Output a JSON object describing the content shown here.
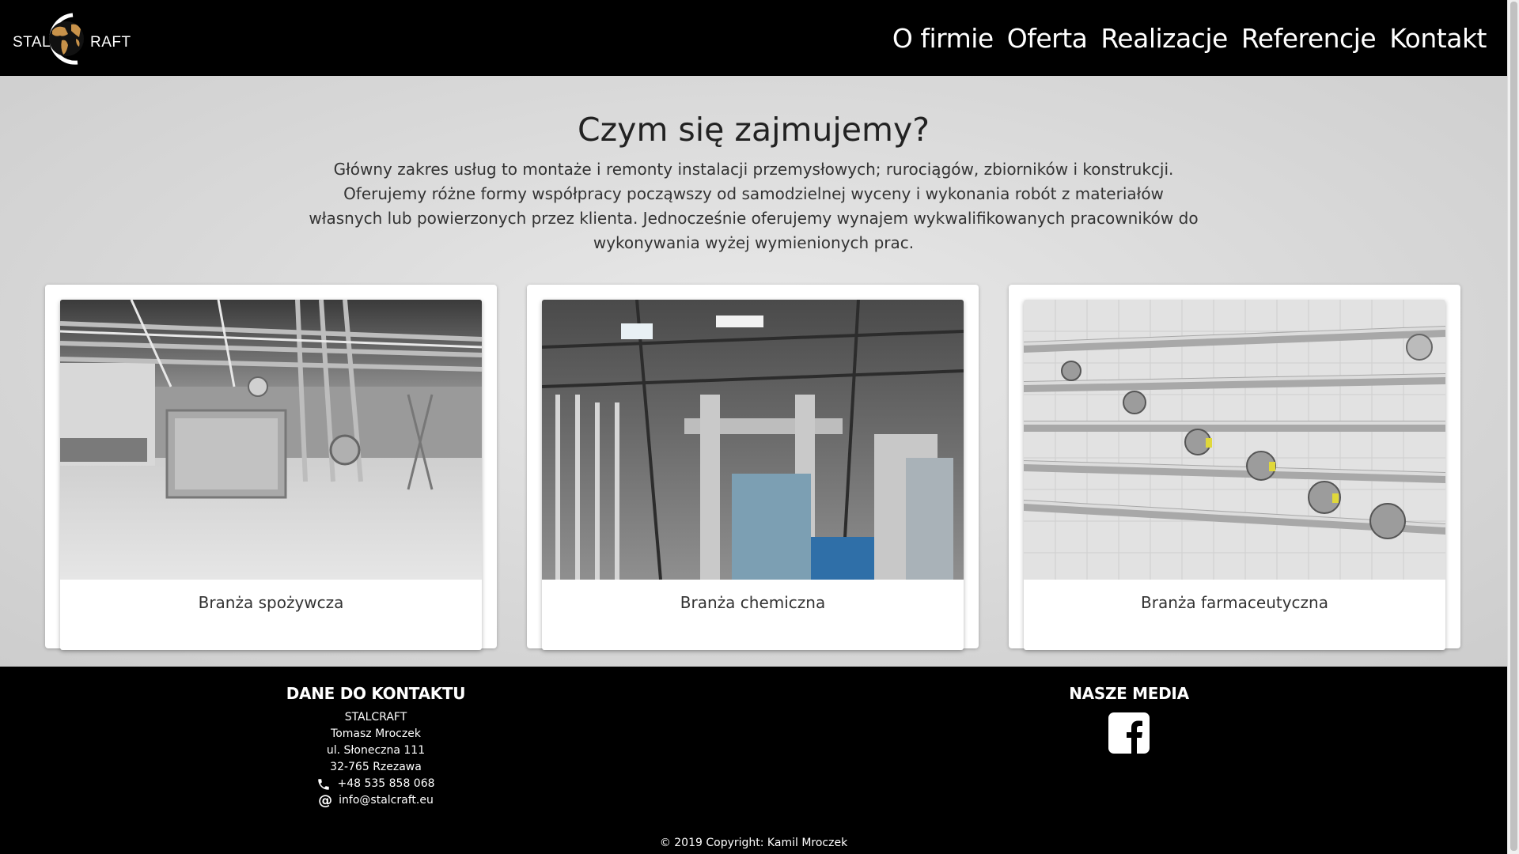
{
  "header": {
    "logo_left": "STAL",
    "logo_right": "RAFT",
    "nav": [
      {
        "label": "O firmie"
      },
      {
        "label": "Oferta"
      },
      {
        "label": "Realizacje"
      },
      {
        "label": "Referencje"
      },
      {
        "label": "Kontakt"
      }
    ]
  },
  "main": {
    "title": "Czym się zajmujemy?",
    "intro": "Główny zakres usług to montaże i remonty instalacji przemysłowych; rurociągów, zbiorników i konstrukcji. Oferujemy różne formy współpracy począwszy od samodzielnej wyceny i wykonania robót z materiałów własnych lub powierzonych przez klienta. Jednocześnie oferujemy wynajem wykwalifikowanych pracowników do wykonywania wyżej wymienionych prac.",
    "cards": [
      {
        "caption": "Branża spożywcza",
        "image": "food-industry-photo"
      },
      {
        "caption": "Branża chemiczna",
        "image": "chemical-industry-photo"
      },
      {
        "caption": "Branża farmaceutyczna",
        "image": "pharmaceutical-industry-photo"
      }
    ]
  },
  "footer": {
    "contact_heading": "DANE DO KONTAKTU",
    "company": "STALCRAFT",
    "person": "Tomasz Mroczek",
    "street": "ul. Słoneczna 111",
    "city": "32-765 Rzezawa",
    "phone": "+48 535 858 068",
    "email": "info@stalcraft.eu",
    "media_heading": "NASZE MEDIA",
    "copyright": "© 2019 Copyright: Kamil Mroczek"
  },
  "colors": {
    "header_bg": "#000000",
    "main_bg": "#d9d9d9",
    "logo_accent": "#c8924a"
  }
}
